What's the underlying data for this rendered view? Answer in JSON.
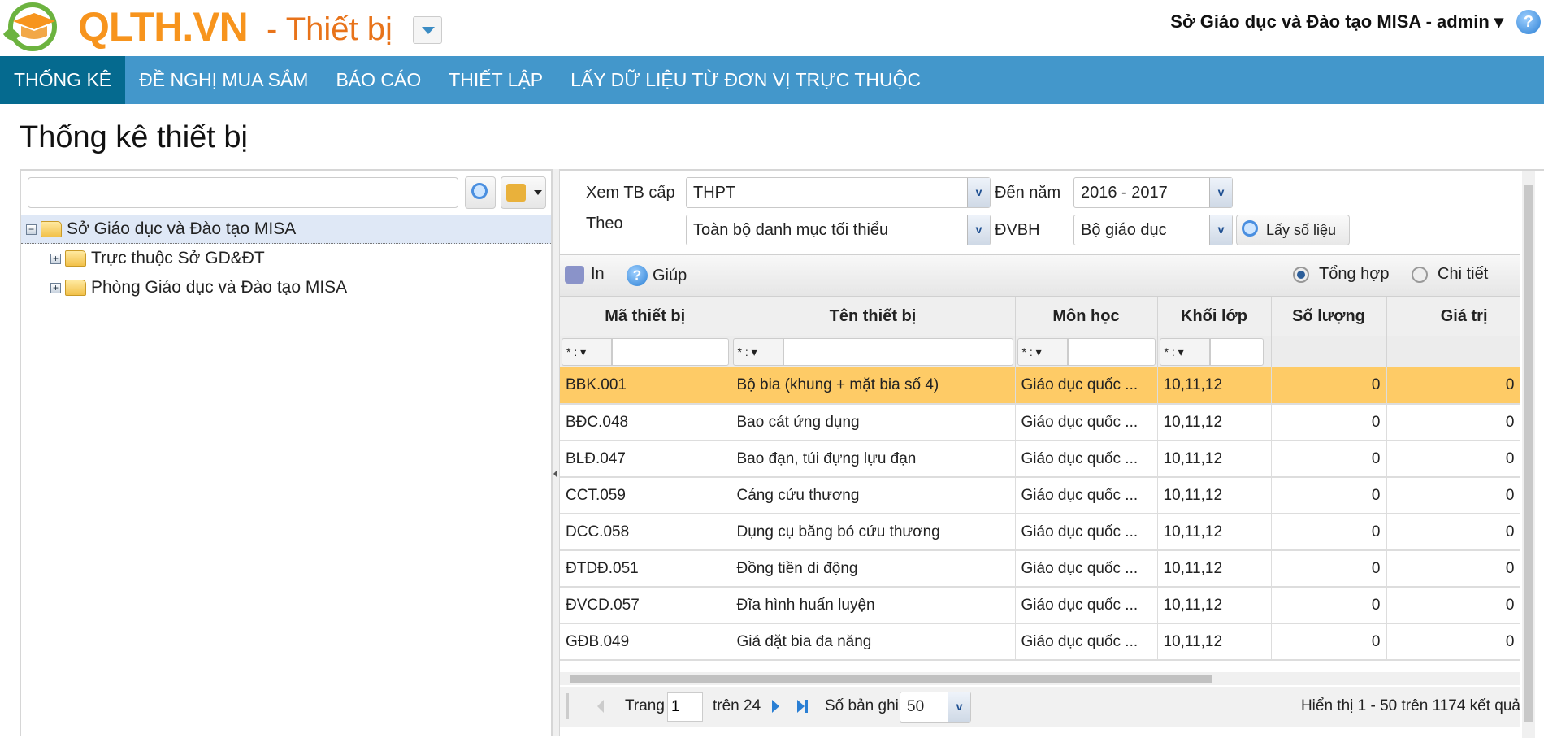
{
  "header": {
    "logo": "QLTH.VN",
    "app_name": "- Thiết bị",
    "user": "Sở Giáo dục và Đào tạo MISA - admin ▾",
    "help": "?"
  },
  "nav": [
    "THỐNG KÊ",
    "ĐỀ NGHỊ MUA SẮM",
    "BÁO CÁO",
    "THIẾT LẬP",
    "LẤY DỮ LIỆU TỪ ĐƠN VỊ TRỰC THUỘC"
  ],
  "page_title": "Thống kê thiết bị",
  "tree": {
    "search_value": "",
    "root": "Sở Giáo dục và Đào tạo MISA",
    "children": [
      "Trực thuộc Sở GD&ĐT",
      "Phòng Giáo dục và Đào tạo MISA"
    ]
  },
  "filters": {
    "level_label": "Xem TB cấp",
    "level": "THPT",
    "year_label": "Đến năm",
    "year": "2016 - 2017",
    "by_label": "Theo",
    "by": "Toàn bộ danh mục tối thiểu",
    "unit_label": "ĐVBH",
    "unit": "Bộ giáo dục",
    "get_button": "Lấy số liệu"
  },
  "toolbar": {
    "print": "In",
    "help": "Giúp",
    "summary": "Tổng hợp",
    "detail": "Chi tiết",
    "mode": "summary"
  },
  "grid": {
    "columns": [
      "Mã thiết bị",
      "Tên thiết bị",
      "Môn học",
      "Khối lớp",
      "Số lượng",
      "Giá trị"
    ],
    "filter_op": "* : ▾",
    "rows": [
      [
        "BBK.001",
        "Bộ bia (khung + mặt bia số 4)",
        "Giáo dục quốc ...",
        "10,11,12",
        "0",
        "0"
      ],
      [
        "BĐC.048",
        "Bao cát ứng dụng",
        "Giáo dục quốc ...",
        "10,11,12",
        "0",
        "0"
      ],
      [
        "BLĐ.047",
        "Bao đạn, túi đựng lựu đạn",
        "Giáo dục quốc ...",
        "10,11,12",
        "0",
        "0"
      ],
      [
        "CCT.059",
        "Cáng cứu thương",
        "Giáo dục quốc ...",
        "10,11,12",
        "0",
        "0"
      ],
      [
        "DCC.058",
        "Dụng cụ băng bó cứu thương",
        "Giáo dục quốc ...",
        "10,11,12",
        "0",
        "0"
      ],
      [
        "ĐTDĐ.051",
        "Đồng tiền di động",
        "Giáo dục quốc ...",
        "10,11,12",
        "0",
        "0"
      ],
      [
        "ĐVCD.057",
        "Đĩa hình huấn luyện",
        "Giáo dục quốc ...",
        "10,11,12",
        "0",
        "0"
      ],
      [
        "GĐB.049",
        "Giá đặt bia đa năng",
        "Giáo dục quốc ...",
        "10,11,12",
        "0",
        "0"
      ]
    ]
  },
  "pager": {
    "page_label": "Trang",
    "page": "1",
    "of": "trên 24",
    "size_label": "Số bản ghi",
    "size": "50",
    "summary": "Hiển thị 1 - 50 trên 1174 kết quả"
  }
}
